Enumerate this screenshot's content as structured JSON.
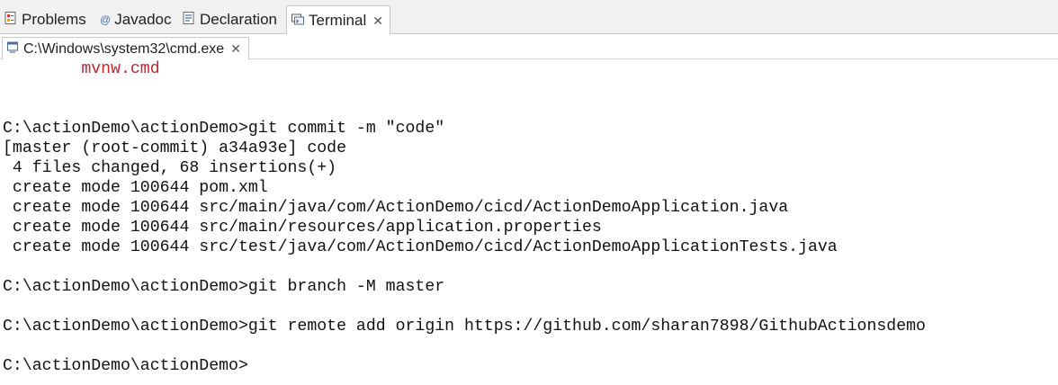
{
  "view_tabs": [
    {
      "label": "Problems",
      "icon": "problems-icon"
    },
    {
      "label": "Javadoc",
      "icon": "javadoc-icon"
    },
    {
      "label": "Declaration",
      "icon": "declaration-icon"
    },
    {
      "label": "Terminal",
      "icon": "terminal-icon",
      "active": true,
      "close_glyph": "✕"
    }
  ],
  "console_tab": {
    "label": "C:\\Windows\\system32\\cmd.exe",
    "icon": "console-icon",
    "close_glyph": "✕"
  },
  "terminal": {
    "lines": [
      "        mvnw.cmd",
      "",
      "",
      "C:\\actionDemo\\actionDemo>git commit -m \"code\"",
      "[master (root-commit) a34a93e] code",
      " 4 files changed, 68 insertions(+)",
      " create mode 100644 pom.xml",
      " create mode 100644 src/main/java/com/ActionDemo/cicd/ActionDemoApplication.java",
      " create mode 100644 src/main/resources/application.properties",
      " create mode 100644 src/test/java/com/ActionDemo/cicd/ActionDemoApplicationTests.java",
      "",
      "C:\\actionDemo\\actionDemo>git branch -M master",
      "",
      "C:\\actionDemo\\actionDemo>git remote add origin https://github.com/sharan7898/GithubActionsdemo",
      "",
      "C:\\actionDemo\\actionDemo>"
    ]
  },
  "colors": {
    "untracked_file_red": "#c1272d"
  }
}
